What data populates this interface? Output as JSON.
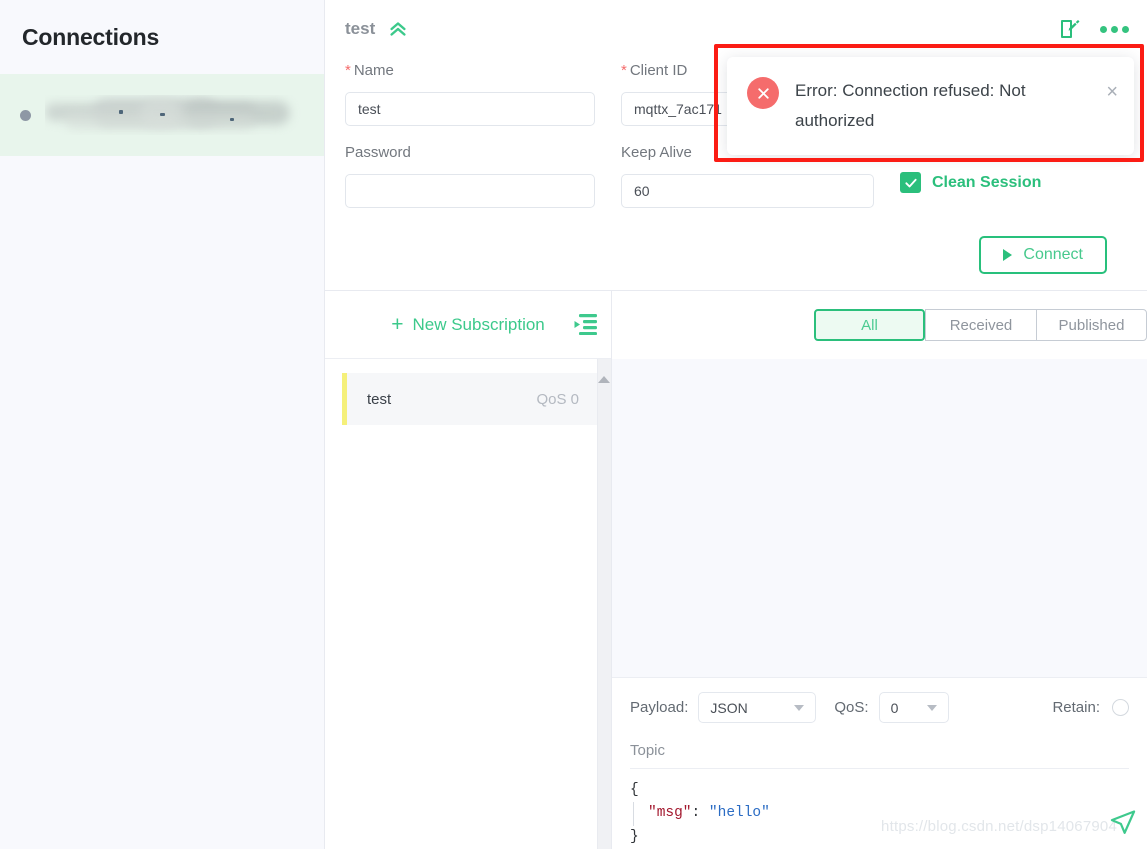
{
  "sidebar": {
    "title": "Connections",
    "items": [
      {
        "name_redacted": true,
        "status": "disconnected",
        "status_color": "#8e98a5"
      }
    ]
  },
  "header": {
    "connection_name": "test",
    "collapse_icon": "chevron-double-up-icon",
    "edit_icon": "edit-pencil-icon",
    "more_icon": "more-dots-icon"
  },
  "form": {
    "name": {
      "label": "Name",
      "required_marker": "*",
      "value": "test",
      "placeholder": ""
    },
    "client_id": {
      "label": "Client ID",
      "required_marker": "*",
      "value": "mqttx_7ac171",
      "placeholder": ""
    },
    "password": {
      "label": "Password",
      "value": "",
      "placeholder": ""
    },
    "keep_alive": {
      "label": "Keep Alive",
      "value": "60",
      "placeholder": ""
    },
    "clean_session": {
      "label": "Clean Session",
      "checked": true,
      "color": "#2bbf7c"
    },
    "connect_button": {
      "label": "Connect",
      "icon": "play-icon",
      "color": "#28c07c"
    }
  },
  "toast": {
    "message": "Error: Connection refused: Not authorized",
    "icon": "error-circle-icon",
    "icon_color": "#f56c6c",
    "close_label": "×"
  },
  "annotation": {
    "type": "rectangle-highlight",
    "color": "#fb1c14"
  },
  "subscriptions": {
    "new_subscription_label": "New Subscription",
    "plus_icon": "plus-icon",
    "collapse_icon": "collapse-list-icon",
    "items": [
      {
        "topic": "test",
        "qos": "QoS 0",
        "color": "#f5f07a"
      }
    ]
  },
  "messages": {
    "tabs": [
      {
        "label": "All",
        "active": true
      },
      {
        "label": "Received",
        "active": false
      },
      {
        "label": "Published",
        "active": false
      }
    ],
    "list": []
  },
  "publish": {
    "payload_label": "Payload:",
    "payload_value": "JSON",
    "qos_label": "QoS:",
    "qos_value": "0",
    "retain_label": "Retain:",
    "retain_checked": false,
    "topic_placeholder": "Topic",
    "topic_value": "",
    "editor": {
      "line1": "{",
      "line2_key": "\"msg\"",
      "line2_sep": ": ",
      "line2_val": "\"hello\"",
      "line3": "}"
    },
    "send_icon": "send-paper-plane-icon"
  },
  "watermark": {
    "text": "https://blog.csdn.net/dsp14067904"
  },
  "colors": {
    "accent_green": "#2bbf7c",
    "error_red": "#f56c6c",
    "annotation_red": "#fb1c14",
    "sidebar_bg": "#f8f9fd",
    "selected_conn_bg": "#e8f5ec"
  }
}
